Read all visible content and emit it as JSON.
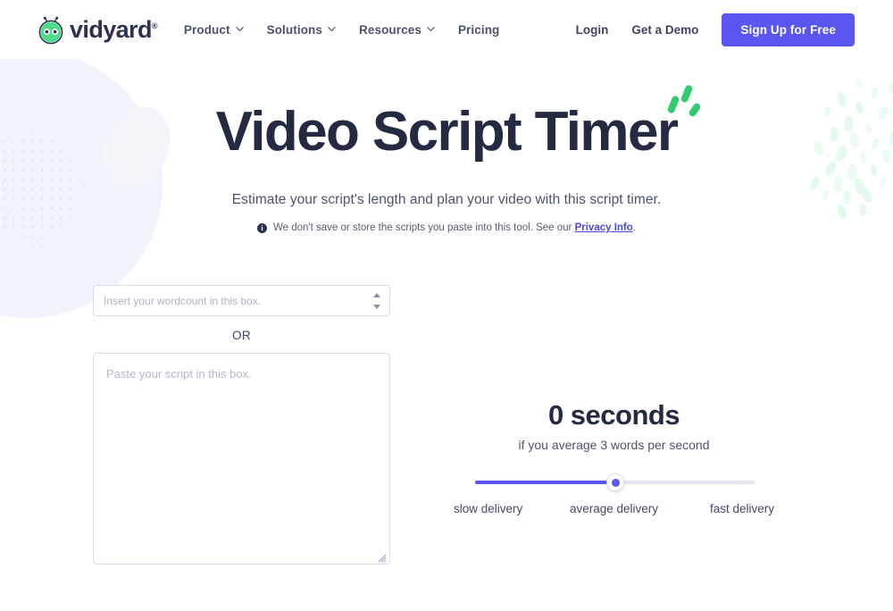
{
  "nav": {
    "logo_text": "vidyard",
    "logo_registered": "®",
    "links": [
      {
        "label": "Product",
        "icon": "chevron-down-icon",
        "has_chevron": true
      },
      {
        "label": "Solutions",
        "icon": "chevron-down-icon",
        "has_chevron": true
      },
      {
        "label": "Resources",
        "icon": "chevron-down-icon",
        "has_chevron": true
      },
      {
        "label": "Pricing",
        "icon": "",
        "has_chevron": false
      }
    ],
    "login_label": "Login",
    "demo_label": "Get a Demo",
    "signup_label": "Sign Up for Free"
  },
  "hero": {
    "title": "Video Script Timer",
    "subtitle": "Estimate your script's length and plan your video with this script timer.",
    "privacy_icon": "info-icon",
    "privacy_text_before": "We don't save or store the scripts you paste into this tool. See our ",
    "privacy_link": "Privacy Info",
    "privacy_text_after": "."
  },
  "tool": {
    "wordcount_placeholder": "Insert your wordcount in this box.",
    "wordcount_value": "",
    "spinner_icon": "number-spinner-icon",
    "or_label": "OR",
    "script_placeholder": "Paste your script in this box.",
    "script_value": "",
    "resize_icon": "resize-grip-icon"
  },
  "result": {
    "seconds_text": "0 seconds",
    "note": "if you average 3 words per second",
    "slider": {
      "value_percent": 50,
      "labels": {
        "slow": "slow delivery",
        "average": "average delivery",
        "fast": "fast delivery"
      }
    }
  },
  "colors": {
    "brand_purple": "#5b56f0",
    "brand_green": "#32cc6f",
    "link_purple": "#4d4ae0",
    "heading_navy": "#242a42",
    "body_gray": "#4c5371",
    "track_gray": "#e3e4ef",
    "border_gray": "#d9dcea",
    "deco_lavender": "#f1f3fb",
    "deco_green_light": "#ddf8e6"
  }
}
